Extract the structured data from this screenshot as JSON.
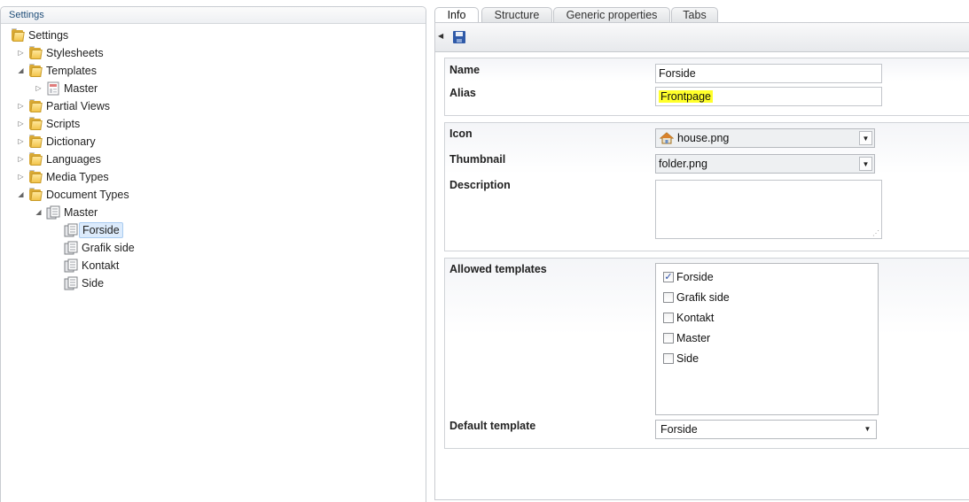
{
  "tree": {
    "header": "Settings",
    "items": [
      {
        "label": "Settings"
      },
      {
        "label": "Stylesheets"
      },
      {
        "label": "Templates"
      },
      {
        "label": "Master"
      },
      {
        "label": "Partial Views"
      },
      {
        "label": "Scripts"
      },
      {
        "label": "Dictionary"
      },
      {
        "label": "Languages"
      },
      {
        "label": "Media Types"
      },
      {
        "label": "Document Types"
      },
      {
        "label": "Master"
      },
      {
        "label": "Forside"
      },
      {
        "label": "Grafik side"
      },
      {
        "label": "Kontakt"
      },
      {
        "label": "Side"
      }
    ],
    "selected": "Forside"
  },
  "tabs": [
    {
      "label": "Info"
    },
    {
      "label": "Structure"
    },
    {
      "label": "Generic properties"
    },
    {
      "label": "Tabs"
    }
  ],
  "active_tab": "Info",
  "form": {
    "name_label": "Name",
    "name_value": "Forside",
    "alias_label": "Alias",
    "alias_value": "Frontpage",
    "icon_label": "Icon",
    "icon_value": "house.png",
    "thumbnail_label": "Thumbnail",
    "thumbnail_value": "folder.png",
    "description_label": "Description",
    "description_value": "",
    "allowed_templates_label": "Allowed templates",
    "allowed_templates": [
      {
        "label": "Forside",
        "checked": true
      },
      {
        "label": "Grafik side",
        "checked": false
      },
      {
        "label": "Kontakt",
        "checked": false
      },
      {
        "label": "Master",
        "checked": false
      },
      {
        "label": "Side",
        "checked": false
      }
    ],
    "default_template_label": "Default template",
    "default_template_value": "Forside"
  },
  "colors": {
    "alias_highlight": "#ffff2a",
    "selected_node_bg": "#dcebfc",
    "save_icon": "#2f5aa8"
  }
}
